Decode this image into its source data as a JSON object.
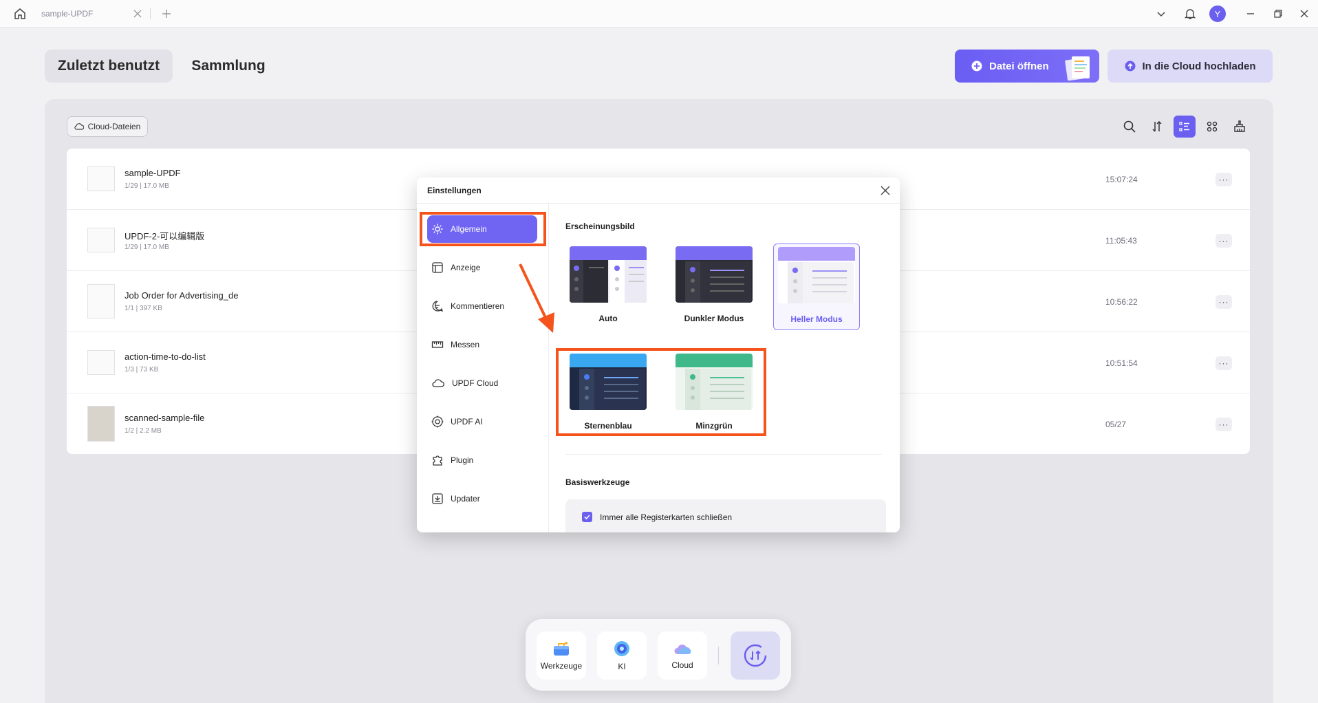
{
  "titlebar": {
    "tab_title": "sample-UPDF",
    "avatar_letter": "Y"
  },
  "header": {
    "tab_recent": "Zuletzt benutzt",
    "tab_collection": "Sammlung",
    "open_file": "Datei öffnen",
    "upload_cloud": "In die Cloud hochladen"
  },
  "panel": {
    "cloud_filter": "Cloud-Dateien"
  },
  "files": [
    {
      "name": "sample-UPDF",
      "meta": "1/29 | 17.0 MB",
      "time": "15:07:24"
    },
    {
      "name": "UPDF-2-可以编辑版",
      "meta": "1/29 | 17.0 MB",
      "time": "11:05:43"
    },
    {
      "name": "Job Order for Advertising_de",
      "meta": "1/1 | 397 KB",
      "time": "10:56:22"
    },
    {
      "name": "action-time-to-do-list",
      "meta": "1/3 | 73 KB",
      "time": "10:51:54"
    },
    {
      "name": "scanned-sample-file",
      "meta": "1/2 | 2.2 MB",
      "time": "05/27"
    }
  ],
  "settings": {
    "title": "Einstellungen",
    "nav": [
      "Allgemein",
      "Anzeige",
      "Kommentieren",
      "Messen",
      "UPDF Cloud",
      "UPDF AI",
      "Plugin",
      "Updater"
    ],
    "appearance_title": "Erscheinungsbild",
    "themes": [
      "Auto",
      "Dunkler Modus",
      "Heller Modus",
      "Sternenblau",
      "Minzgrün"
    ],
    "selected_theme": "Heller Modus",
    "basic_tools_title": "Basiswerkzeuge",
    "close_tabs_option": "Immer alle Registerkarten schließen"
  },
  "dock": {
    "tools": "Werkzeuge",
    "ai": "KI",
    "cloud": "Cloud"
  },
  "colors": {
    "accent": "#6b5ff0",
    "highlight": "#f4541c"
  }
}
